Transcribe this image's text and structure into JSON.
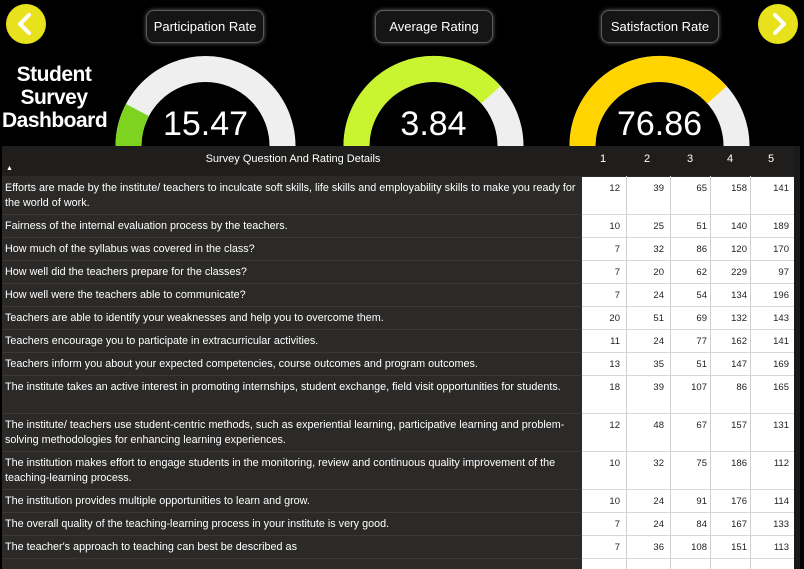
{
  "dashboard_title": "Student Survey Dashboard",
  "title_lines": [
    "Student",
    "Survey",
    "Dashboard"
  ],
  "kpis": [
    {
      "label": "Participation Rate",
      "value": "15.47",
      "fraction": 0.1547,
      "color": "#7ed321"
    },
    {
      "label": "Average Rating",
      "value": "3.84",
      "fraction": 0.768,
      "color": "#c8f52f"
    },
    {
      "label": "Satisfaction Rate",
      "value": "76.86",
      "fraction": 0.7686,
      "color": "#ffd400"
    }
  ],
  "colors": {
    "track": "#efefef",
    "nav": "#e8e21c",
    "panel": "#2b2a28"
  },
  "table": {
    "question_header": "Survey Question And Rating Details",
    "columns": [
      "1",
      "2",
      "3",
      "4",
      "5"
    ],
    "rows": [
      {
        "q": "Efforts are made by the institute/ teachers to inculcate soft skills, life skills and employability skills to make you ready for the world of work.",
        "v": [
          "12",
          "39",
          "65",
          "158",
          "141"
        ]
      },
      {
        "q": "Fairness of the internal evaluation process by the teachers.",
        "v": [
          "10",
          "25",
          "51",
          "140",
          "189"
        ]
      },
      {
        "q": "How much of the syllabus was covered in the class?",
        "v": [
          "7",
          "32",
          "86",
          "120",
          "170"
        ]
      },
      {
        "q": "How well did the teachers prepare for the classes?",
        "v": [
          "7",
          "20",
          "62",
          "229",
          "97"
        ]
      },
      {
        "q": "How well were the teachers able to communicate?",
        "v": [
          "7",
          "24",
          "54",
          "134",
          "196"
        ]
      },
      {
        "q": "Teachers are able to identify your weaknesses and help you to overcome them.",
        "v": [
          "20",
          "51",
          "69",
          "132",
          "143"
        ]
      },
      {
        "q": "Teachers encourage you to participate in extracurricular activities.",
        "v": [
          "11",
          "24",
          "77",
          "162",
          "141"
        ]
      },
      {
        "q": "Teachers inform you about your expected competencies, course outcomes and program outcomes.",
        "v": [
          "13",
          "35",
          "51",
          "147",
          "169"
        ]
      },
      {
        "q": "The institute takes an active interest in promoting internships, student exchange, field visit opportunities for students.",
        "v": [
          "18",
          "39",
          "107",
          "86",
          "165"
        ]
      },
      {
        "q": "The institute/ teachers use student-centric methods, such as experiential learning, participative learning and problem-solving methodologies for enhancing learning experiences.",
        "v": [
          "12",
          "48",
          "67",
          "157",
          "131"
        ]
      },
      {
        "q": "The institution makes effort to engage students in the monitoring, review and continuous quality improvement of the teaching-learning process.",
        "v": [
          "10",
          "32",
          "75",
          "186",
          "112"
        ]
      },
      {
        "q": "The institution provides multiple opportunities to learn and grow.",
        "v": [
          "10",
          "24",
          "91",
          "176",
          "114"
        ]
      },
      {
        "q": "The overall quality of the teaching-learning process in your institute is very good.",
        "v": [
          "7",
          "24",
          "84",
          "167",
          "133"
        ]
      },
      {
        "q": "The teacher's approach to teaching can best be described as",
        "v": [
          "7",
          "36",
          "108",
          "151",
          "113"
        ]
      }
    ]
  }
}
